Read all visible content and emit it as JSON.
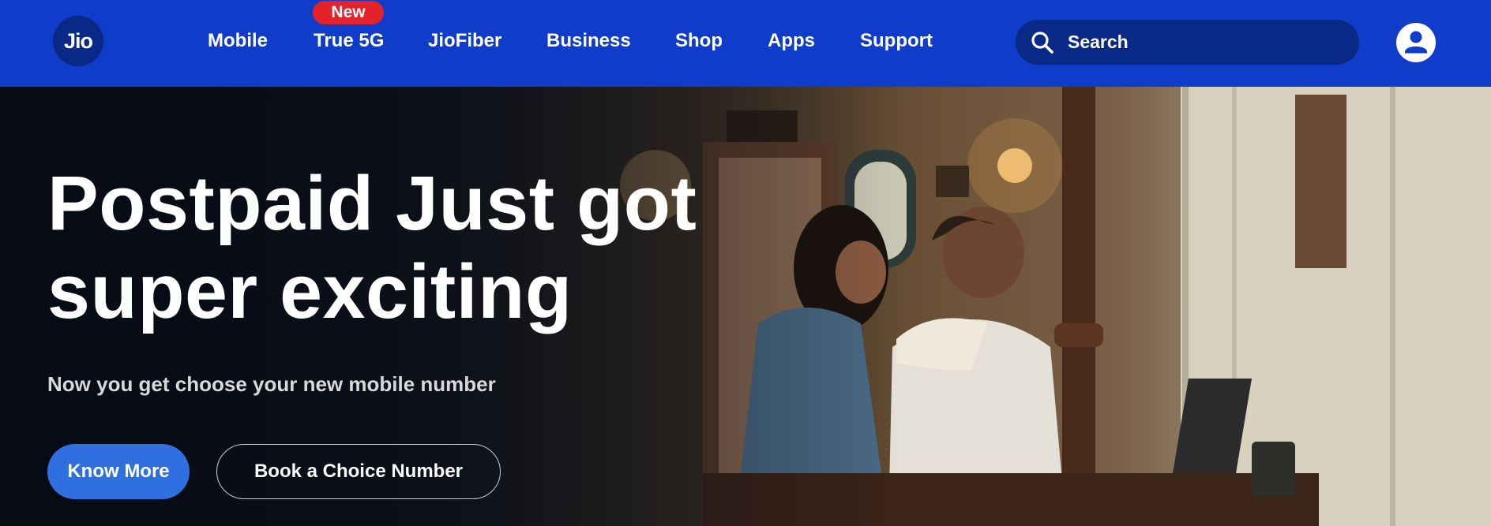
{
  "header": {
    "logo_text": "Jio",
    "nav": [
      {
        "label": "Mobile"
      },
      {
        "label": "True 5G",
        "badge": "New"
      },
      {
        "label": "JioFiber"
      },
      {
        "label": "Business"
      },
      {
        "label": "Shop"
      },
      {
        "label": "Apps"
      },
      {
        "label": "Support"
      }
    ],
    "search": {
      "placeholder": "Search",
      "icon": "search-icon"
    },
    "profile_icon": "user-icon"
  },
  "hero": {
    "title_line1": "Postpaid Just got",
    "title_line2": "super exciting",
    "subtitle": "Now you get choose your new mobile number",
    "primary_button": "Know More",
    "secondary_button": "Book a Choice Number"
  },
  "colors": {
    "header_bg": "#0f3cc9",
    "logo_bg": "#0a2885",
    "search_bg": "#0a2885",
    "badge_bg": "#e4222a",
    "primary_button_bg": "#2f6fe0"
  }
}
